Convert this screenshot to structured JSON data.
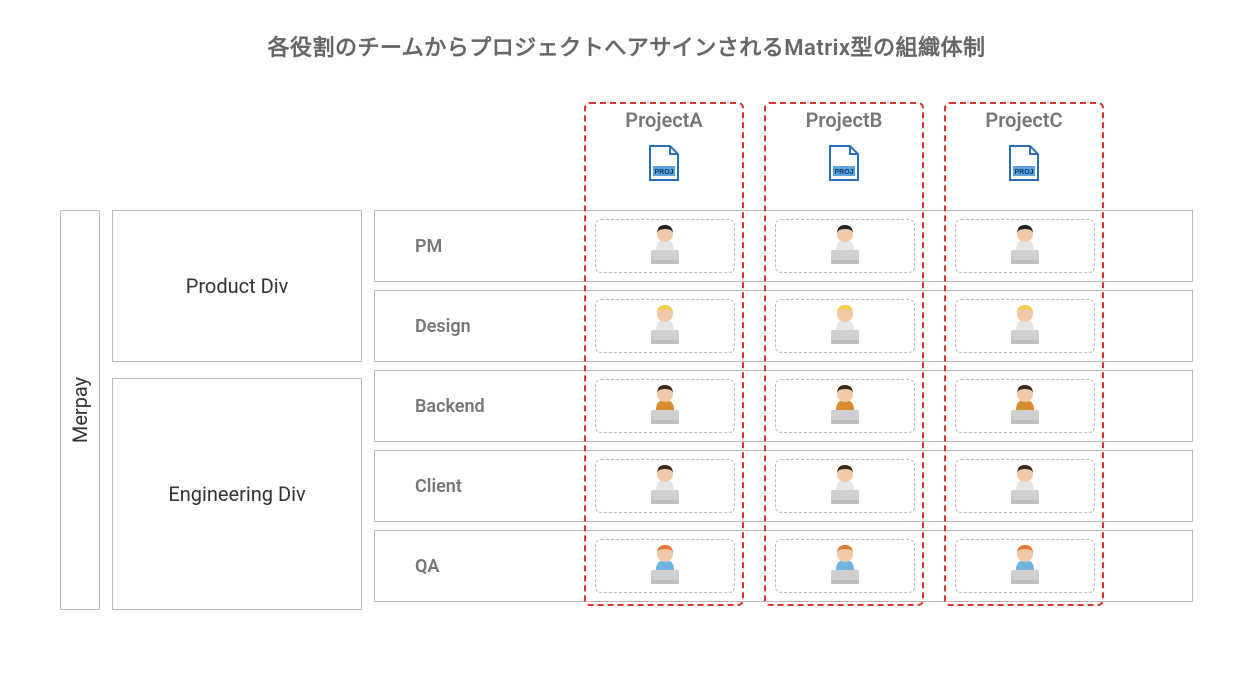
{
  "title": "各役割のチームからプロジェクトへアサインされるMatrix型の組織体制",
  "company": "Merpay",
  "divisions": [
    {
      "name": "Product Div",
      "roles": [
        "PM",
        "Design"
      ]
    },
    {
      "name": "Engineering Div",
      "roles": [
        "Backend",
        "Client",
        "QA"
      ]
    }
  ],
  "roles": [
    "PM",
    "Design",
    "Backend",
    "Client",
    "QA"
  ],
  "projects": [
    "ProjectA",
    "ProjectB",
    "ProjectC"
  ],
  "proj_file_label": "PROJ",
  "colors": {
    "border": "#bbbbbb",
    "project_border": "#d33333",
    "heading_text": "#666666",
    "label_text": "#777777"
  },
  "avatars": {
    "PM": {
      "hair": "#222222",
      "skin": "#f3c9a5",
      "shirt": "#e6e6e6",
      "laptop": "#d0d0d0"
    },
    "Design": {
      "hair": "#f5cc4a",
      "skin": "#f3c9a5",
      "shirt": "#e6e6e6",
      "laptop": "#d0d0d0"
    },
    "Backend": {
      "hair": "#3b2a1a",
      "skin": "#f3c9a5",
      "shirt": "#d98b2e",
      "laptop": "#d0d0d0"
    },
    "Client": {
      "hair": "#3b2a1a",
      "skin": "#f3c9a5",
      "shirt": "#e6e6e6",
      "laptop": "#d0d0d0"
    },
    "QA": {
      "hair": "#e07a3a",
      "skin": "#f3c9a5",
      "shirt": "#6fb4e0",
      "laptop": "#d0d0d0"
    }
  }
}
